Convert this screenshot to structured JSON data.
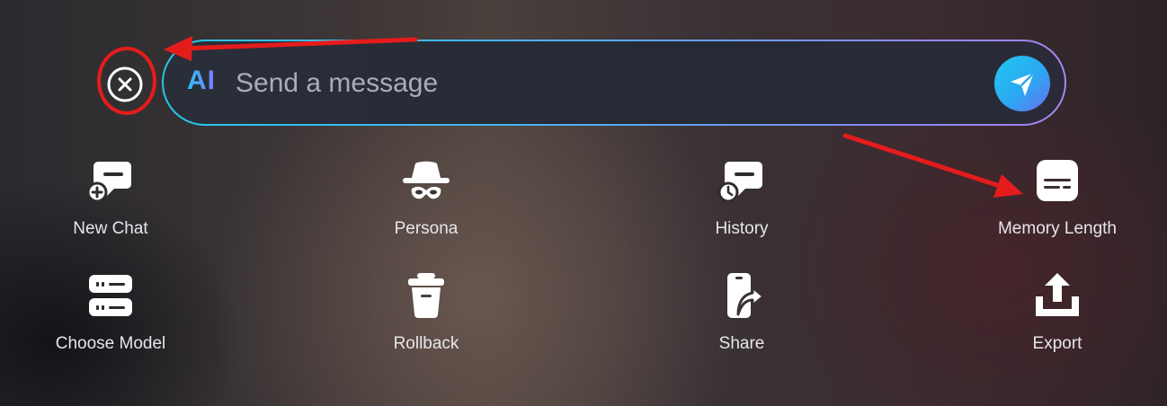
{
  "composer": {
    "ai_badge": "AI",
    "placeholder": "Send a message"
  },
  "menu": {
    "row1": [
      {
        "label": "New Chat",
        "icon": "new-chat-icon"
      },
      {
        "label": "Persona",
        "icon": "incognito-hat-icon"
      },
      {
        "label": "History",
        "icon": "chat-history-icon"
      },
      {
        "label": "Memory Length",
        "icon": "memory-length-icon"
      }
    ],
    "row2": [
      {
        "label": "Choose Model",
        "icon": "server-model-icon"
      },
      {
        "label": "Rollback",
        "icon": "trash-bin-icon"
      },
      {
        "label": "Share",
        "icon": "share-phone-icon"
      },
      {
        "label": "Export",
        "icon": "export-icon"
      }
    ]
  },
  "colors": {
    "accent_start": "#27c6e8",
    "accent_end": "#a686ee",
    "annotation_red": "#e51c1c"
  }
}
